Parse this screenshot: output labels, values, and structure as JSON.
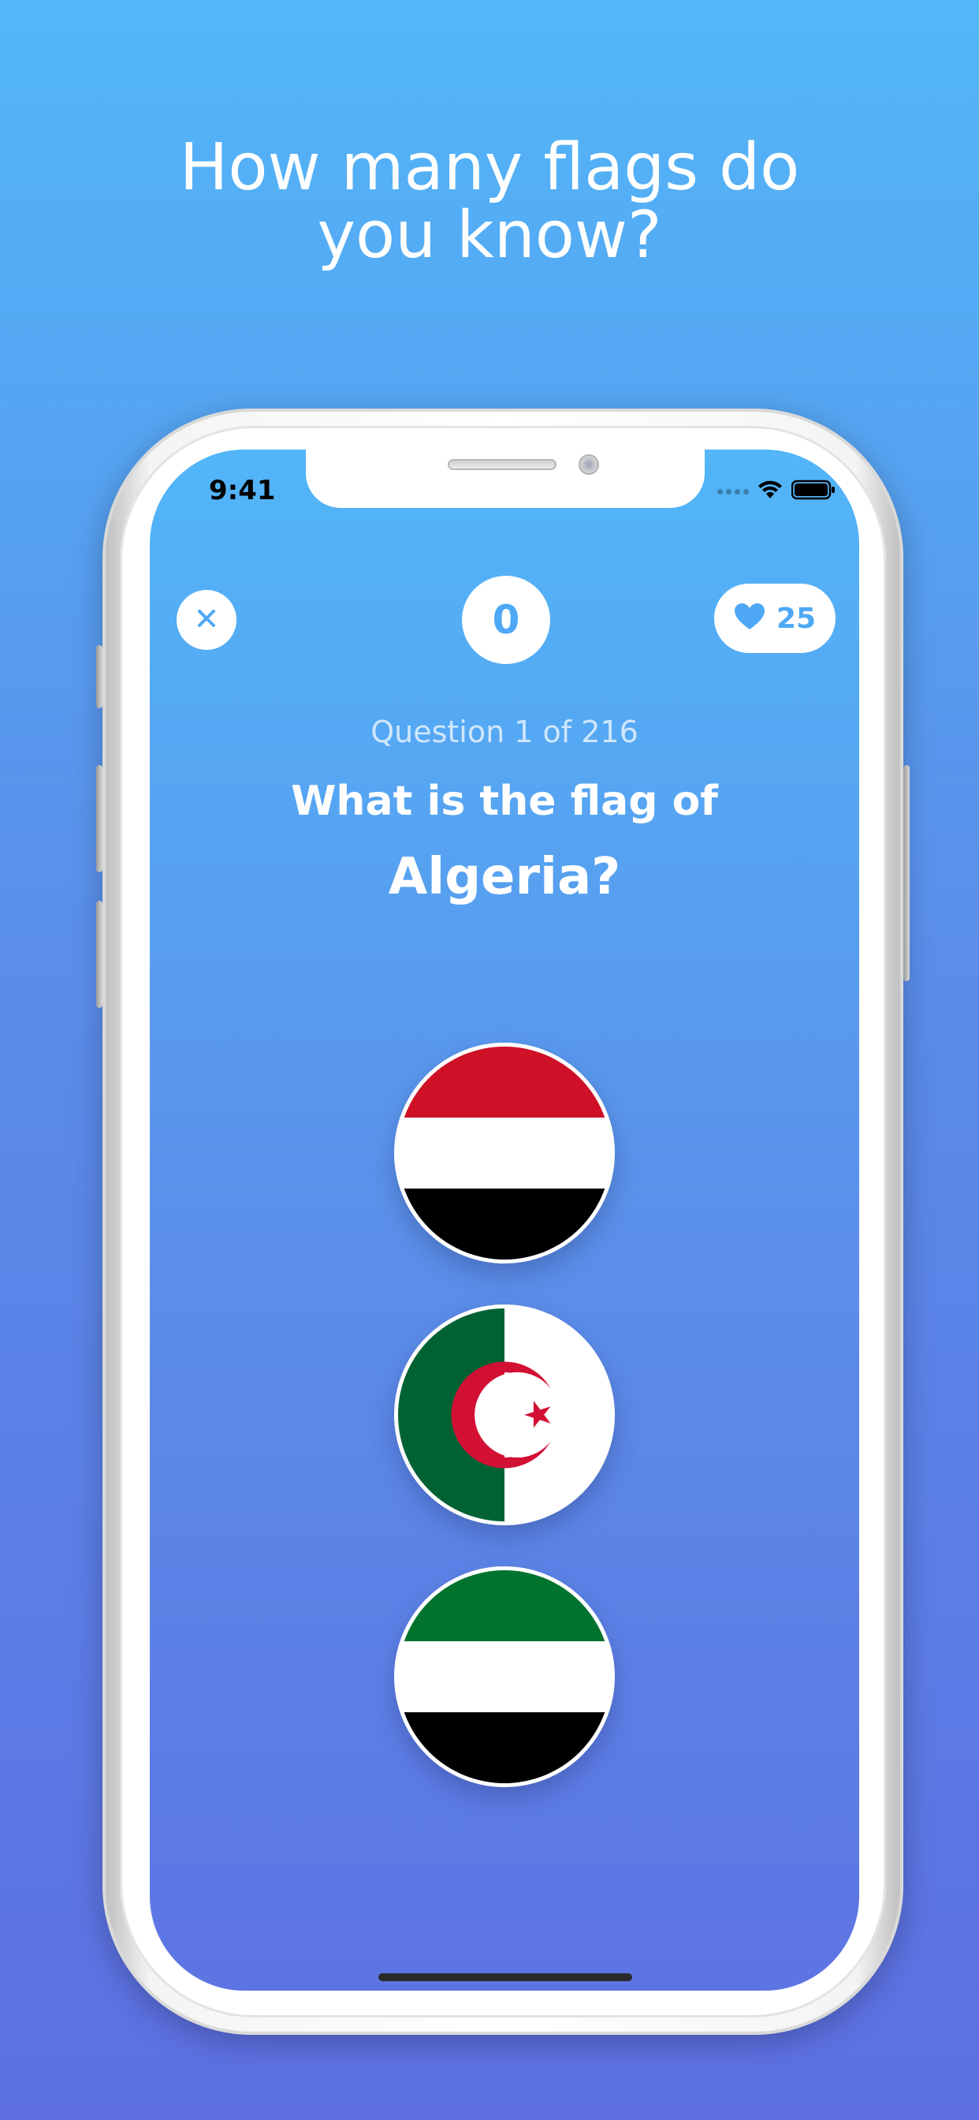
{
  "headline": {
    "line1": "How many flags do",
    "line2": "you know?"
  },
  "status_bar": {
    "time": "9:41",
    "icons": [
      "cellular-dots-icon",
      "wifi-icon",
      "battery-icon"
    ]
  },
  "game_header": {
    "close_icon": "close-icon",
    "score": "0",
    "lives_icon": "heart-icon",
    "lives": "25"
  },
  "question": {
    "progress": "Question 1 of 216",
    "prompt": "What is the flag of",
    "country": "Algeria?"
  },
  "options": [
    {
      "flag": "Yemen",
      "colors": [
        "#ce1126",
        "#ffffff",
        "#000000"
      ]
    },
    {
      "flag": "Algeria",
      "colors": [
        "#006233",
        "#ffffff",
        "#d21034"
      ]
    },
    {
      "flag": "Green, white and black tricolour",
      "colors": [
        "#00732f",
        "#ffffff",
        "#000000"
      ]
    }
  ],
  "colors": {
    "background_top": "#52b7f8",
    "background_bottom": "#5d6fe2",
    "accent": "#4fa8f5"
  }
}
